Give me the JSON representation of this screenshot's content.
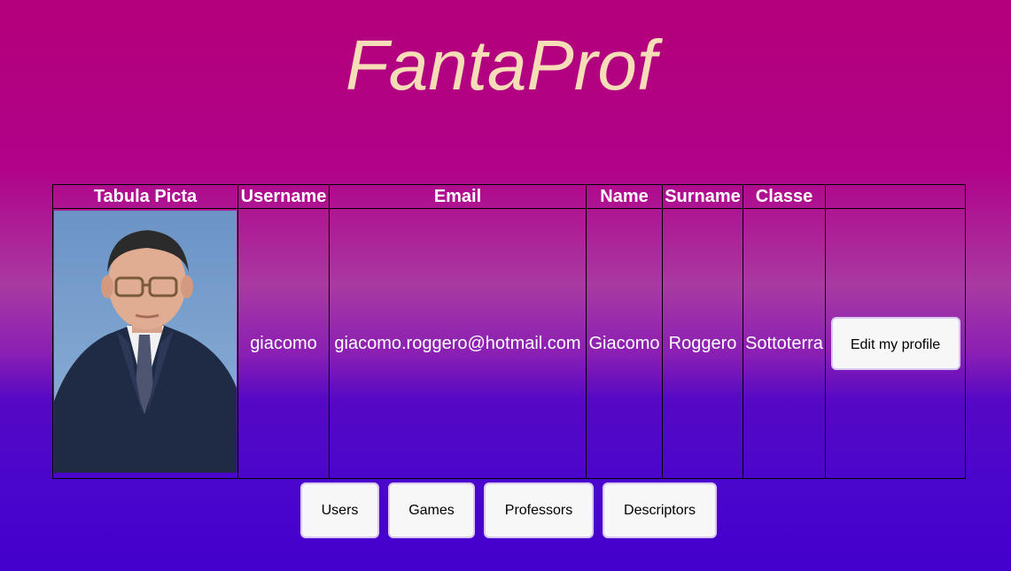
{
  "app": {
    "title": "FantaProf"
  },
  "table": {
    "headers": [
      "Tabula Picta",
      "Username",
      "Email",
      "Name",
      "Surname",
      "Classe",
      ""
    ],
    "row": {
      "username": "giacomo",
      "email": "giacomo.roggero@hotmail.com",
      "name": "Giacomo",
      "surname": "Roggero",
      "classe": "Sottoterra",
      "edit_label": "Edit my profile"
    }
  },
  "nav": {
    "buttons": [
      "Users",
      "Games",
      "Professors",
      "Descriptors"
    ]
  }
}
